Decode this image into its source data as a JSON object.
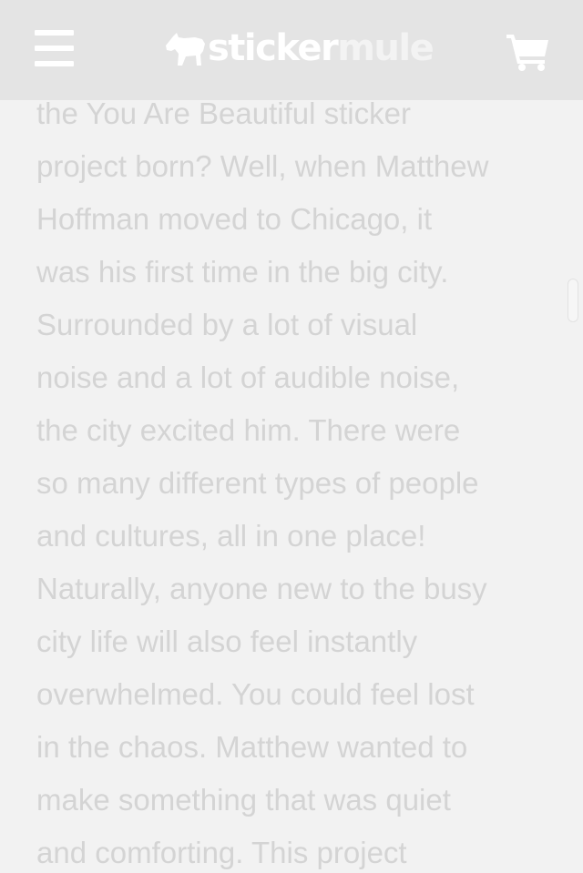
{
  "header": {
    "logo": {
      "text_part1": "sticker",
      "text_part2": "mule",
      "icon": "mule-logo-icon"
    },
    "menu_icon": "hamburger-menu-icon",
    "cart_icon": "shopping-cart-icon"
  },
  "article": {
    "lines": [
      "the You Are Beautiful sticker",
      "project born? Well, when Matthew",
      "Hoffman moved to Chicago, it",
      "was his first time in the big city.",
      "Surrounded by a lot of visual",
      "noise and a lot of audible noise,",
      "the city excited him. There were",
      "so many different types of people",
      "and cultures, all in one place!",
      "Naturally, anyone new to the busy",
      "city life will also feel instantly",
      "overwhelmed. You could feel lost",
      "in the chaos. Matthew wanted to",
      "make something that was quiet",
      "and comforting. This project"
    ]
  },
  "colors": {
    "header_bg": "#e4e4e4",
    "page_bg": "#f2f2f2",
    "text": "#d4d4d4",
    "icon": "#ffffff"
  }
}
